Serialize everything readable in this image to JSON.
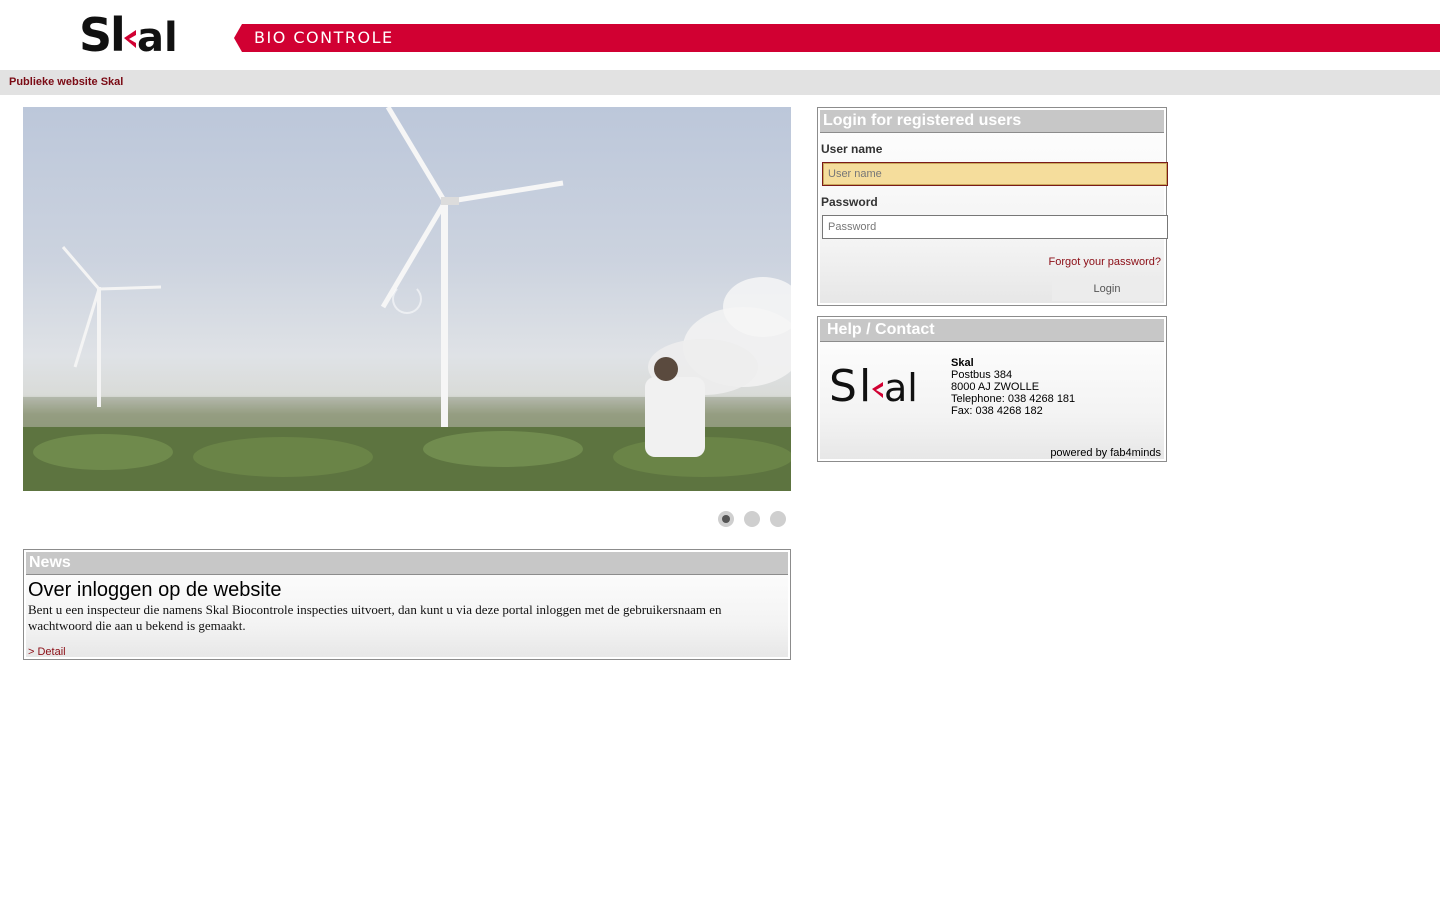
{
  "header": {
    "logo_text": "Skal",
    "banner_text": "BIO CONTROLE",
    "brand_color": "#d10032"
  },
  "nav": {
    "public_link": "Publieke website Skal"
  },
  "slideshow": {
    "slide_count": 3,
    "active_slide": 1
  },
  "news": {
    "title": "News",
    "headline": "Over inloggen op de website",
    "body": "Bent u een inspecteur die namens Skal Biocontrole inspecties uitvoert, dan kunt u via deze portal inloggen met de gebruikersnaam en wachtwoord die aan u bekend is gemaakt.",
    "detail_link": "> Detail"
  },
  "login": {
    "title": "Login for registered users",
    "username_label": "User name",
    "username_placeholder": "User name",
    "password_label": "Password",
    "password_placeholder": "Password",
    "forgot_link": "Forgot your password?",
    "login_button": "Login"
  },
  "help": {
    "title": "Help / Contact",
    "org": "Skal",
    "address1": "Postbus 384",
    "address2": "8000 AJ ZWOLLE",
    "phone": "Telephone: 038 4268 181",
    "fax": "Fax: 038 4268 182",
    "powered": "powered by fab4minds"
  }
}
